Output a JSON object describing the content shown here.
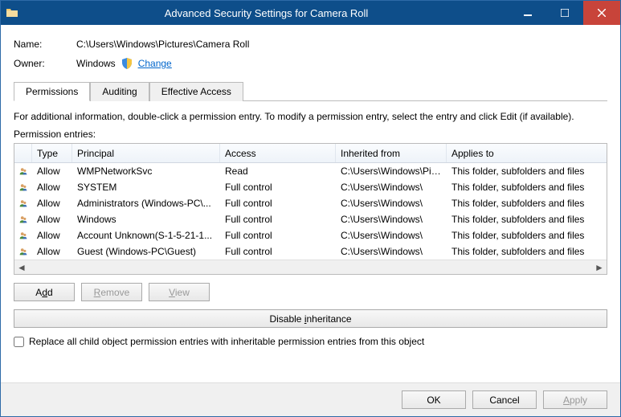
{
  "window": {
    "title": "Advanced Security Settings for Camera Roll"
  },
  "info": {
    "name_label": "Name:",
    "name_value": "C:\\Users\\Windows\\Pictures\\Camera Roll",
    "owner_label": "Owner:",
    "owner_value": "Windows",
    "change_label": "Change"
  },
  "tabs": {
    "permissions": "Permissions",
    "auditing": "Auditing",
    "effective": "Effective Access"
  },
  "body": {
    "description": "For additional information, double-click a permission entry. To modify a permission entry, select the entry and click Edit (if available).",
    "entries_label": "Permission entries:"
  },
  "columns": {
    "type": "Type",
    "principal": "Principal",
    "access": "Access",
    "inherited": "Inherited from",
    "applies": "Applies to"
  },
  "entries": [
    {
      "type": "Allow",
      "principal": "WMPNetworkSvc",
      "access": "Read",
      "inherited": "C:\\Users\\Windows\\Pic...",
      "applies": "This folder, subfolders and files"
    },
    {
      "type": "Allow",
      "principal": "SYSTEM",
      "access": "Full control",
      "inherited": "C:\\Users\\Windows\\",
      "applies": "This folder, subfolders and files"
    },
    {
      "type": "Allow",
      "principal": "Administrators (Windows-PC\\...",
      "access": "Full control",
      "inherited": "C:\\Users\\Windows\\",
      "applies": "This folder, subfolders and files"
    },
    {
      "type": "Allow",
      "principal": "Windows",
      "access": "Full control",
      "inherited": "C:\\Users\\Windows\\",
      "applies": "This folder, subfolders and files"
    },
    {
      "type": "Allow",
      "principal": "Account Unknown(S-1-5-21-1...",
      "access": "Full control",
      "inherited": "C:\\Users\\Windows\\",
      "applies": "This folder, subfolders and files"
    },
    {
      "type": "Allow",
      "principal": "Guest (Windows-PC\\Guest)",
      "access": "Full control",
      "inherited": "C:\\Users\\Windows\\",
      "applies": "This folder, subfolders and files"
    }
  ],
  "buttons": {
    "add": "Add",
    "remove": "Remove",
    "view": "View",
    "disable_inheritance": "Disable inheritance",
    "replace_label": "Replace all child object permission entries with inheritable permission entries from this object",
    "ok": "OK",
    "cancel": "Cancel",
    "apply": "Apply"
  }
}
